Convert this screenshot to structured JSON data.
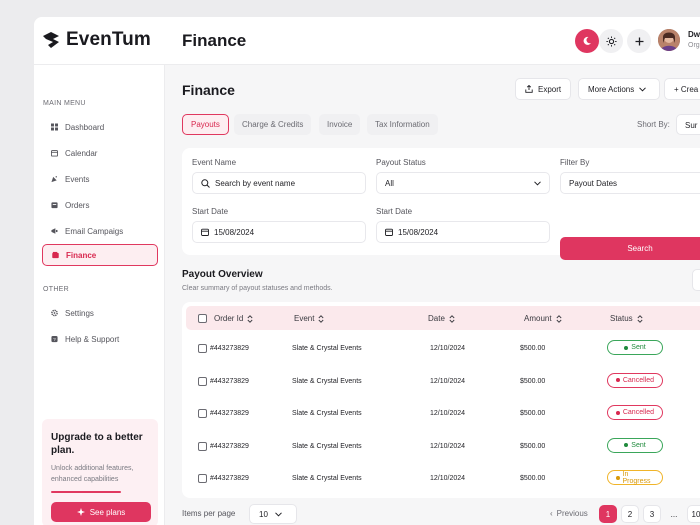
{
  "app": {
    "name": "EvenTum",
    "page_title": "Finance"
  },
  "user": {
    "name": "Dwi",
    "role": "Org"
  },
  "sidebar": {
    "main_label": "MAIN MENU",
    "other_label": "OTHER",
    "items": [
      {
        "label": "Dashboard",
        "icon": "dashboard-icon"
      },
      {
        "label": "Calendar",
        "icon": "calendar-icon"
      },
      {
        "label": "Events",
        "icon": "events-icon"
      },
      {
        "label": "Orders",
        "icon": "orders-icon"
      },
      {
        "label": "Email Campaigs",
        "icon": "megaphone-icon"
      },
      {
        "label": "Finance",
        "icon": "wallet-icon",
        "active": true
      }
    ],
    "other_items": [
      {
        "label": "Settings",
        "icon": "gear-icon"
      },
      {
        "label": "Help & Support",
        "icon": "help-icon"
      }
    ]
  },
  "upgrade": {
    "title": "Upgrade to a better plan.",
    "text": "Unlock additional features, enhanced capabilities",
    "button": "See plans",
    "progress": 0.7
  },
  "main": {
    "title": "Finance",
    "export_label": "Export",
    "more_actions_label": "More Actions",
    "create_label": "+ Crea",
    "tabs": [
      "Payouts",
      "Charge & Credits",
      "Invoice",
      "Tax Information"
    ],
    "sort_label": "Short By:",
    "sort_value": "Sur"
  },
  "filters": {
    "event_name_label": "Event Name",
    "event_name_placeholder": "Search by event name",
    "payout_status_label": "Payout Status",
    "payout_status_value": "All",
    "filter_by_label": "Filter By",
    "filter_by_value": "Payout Dates",
    "start_date_label": "Start Date",
    "start_date_value": "15/08/2024",
    "start_date2_label": "Start Date",
    "start_date2_value": "15/08/2024",
    "search_label": "Search"
  },
  "overview": {
    "title": "Payout Overview",
    "subtitle": "Clear summary of payout statuses and methods."
  },
  "table": {
    "headers": [
      "Order Id",
      "Event",
      "Date",
      "Amount",
      "Status"
    ],
    "rows": [
      {
        "order_id": "#443273829",
        "event": "Slate & Crystal Events",
        "date": "12/10/2024",
        "amount": "$500.00",
        "status": "Sent"
      },
      {
        "order_id": "#443273829",
        "event": "Slate & Crystal Events",
        "date": "12/10/2024",
        "amount": "$500.00",
        "status": "Cancelled"
      },
      {
        "order_id": "#443273829",
        "event": "Slate & Crystal Events",
        "date": "12/10/2024",
        "amount": "$500.00",
        "status": "Cancelled"
      },
      {
        "order_id": "#443273829",
        "event": "Slate & Crystal Events",
        "date": "12/10/2024",
        "amount": "$500.00",
        "status": "Sent"
      },
      {
        "order_id": "#443273829",
        "event": "Slate & Crystal Events",
        "date": "12/10/2024",
        "amount": "$500.00",
        "status": "In Progress"
      }
    ]
  },
  "status_colors": {
    "Sent": {
      "fg": "#1f8a3c",
      "border": "#3aa65a",
      "bg": "#ffffff"
    },
    "Cancelled": {
      "fg": "#d8284f",
      "border": "#e0385f",
      "bg": "#ffffff"
    },
    "In Progress": {
      "fg": "#d99a0a",
      "border": "#f0b429",
      "bg": "#ffffff"
    }
  },
  "pagination": {
    "items_label": "Items per page",
    "per_page": "10",
    "prev_label": "Previous",
    "pages": [
      "1",
      "2",
      "3",
      "...",
      "10"
    ]
  },
  "theme": {
    "accent": "#df3660",
    "accent_soft": "#fdeef1"
  }
}
